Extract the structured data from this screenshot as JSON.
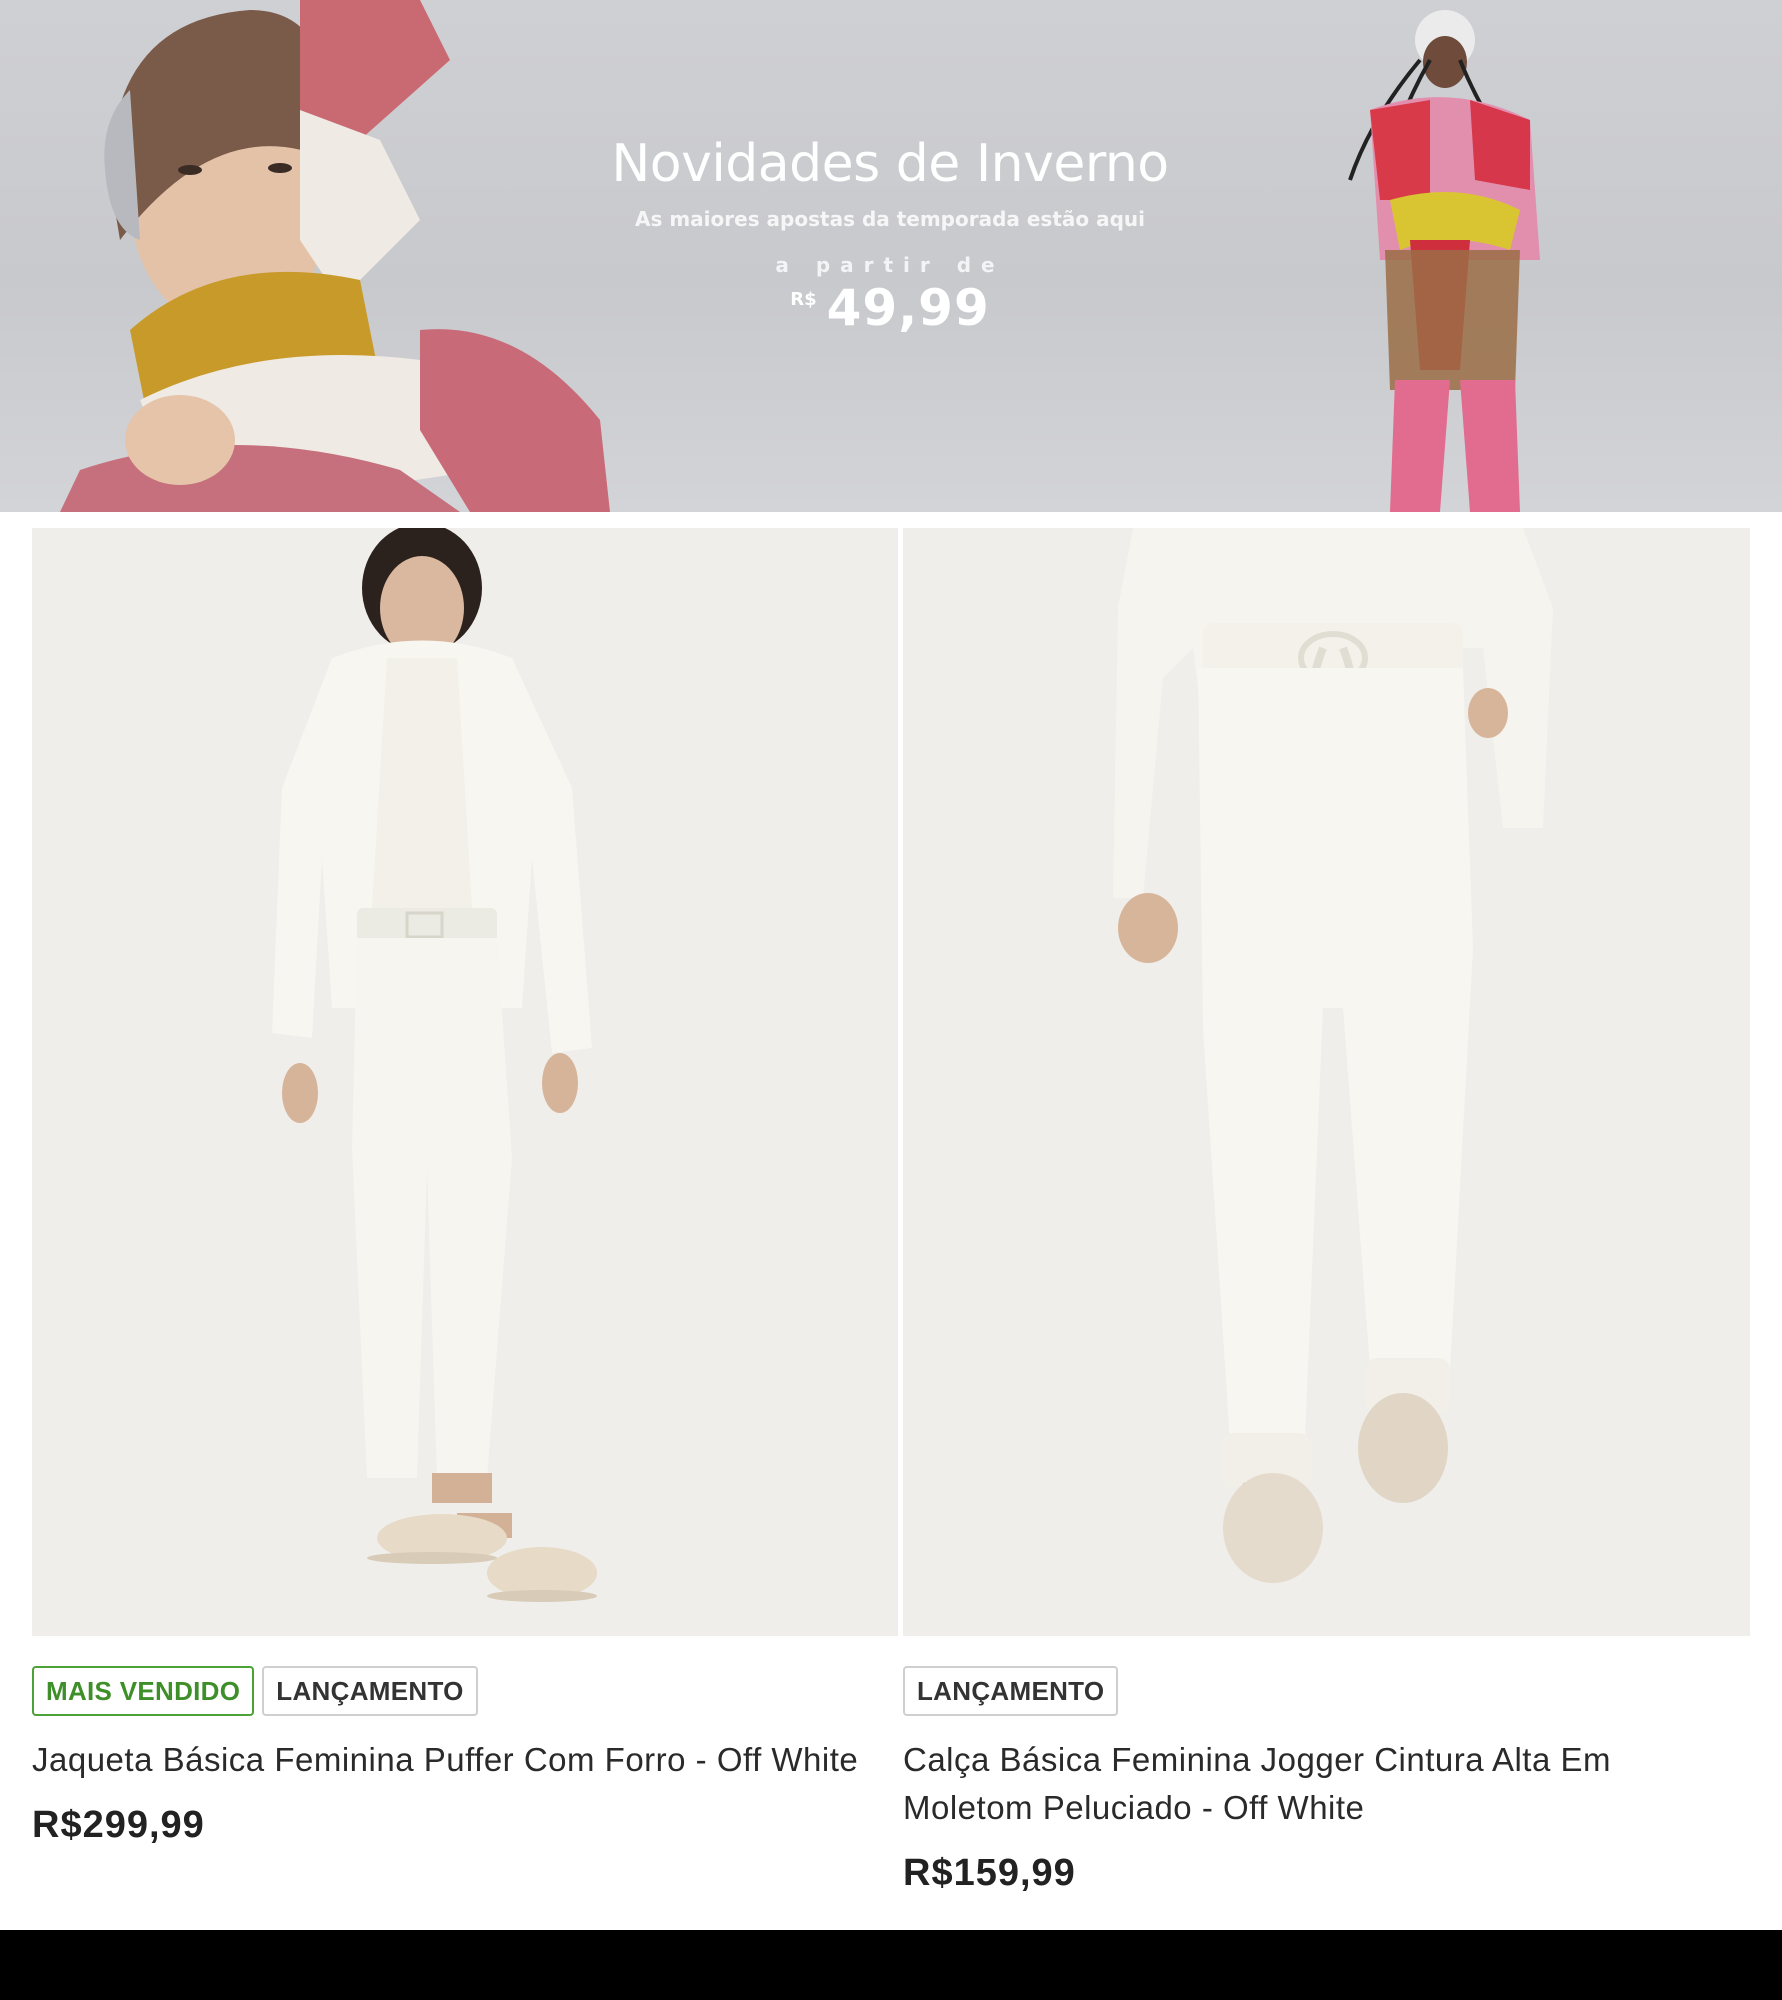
{
  "banner": {
    "title": "Novidades de Inverno",
    "subtitle": "As maiores apostas da temporada estão aqui",
    "from_label": "a partir de",
    "currency": "R$",
    "price": "49,99"
  },
  "products": [
    {
      "badges": [
        "MAIS VENDIDO",
        "LANÇAMENTO"
      ],
      "name": "Jaqueta Básica Feminina Puffer Com Forro - Off White",
      "price": "R$299,99"
    },
    {
      "badges": [
        "LANÇAMENTO"
      ],
      "name": "Calça Básica Feminina Jogger Cintura Alta Em Moletom Peluciado - Off White",
      "price": "R$159,99"
    }
  ],
  "colors": {
    "badge_bestseller": "#4ca236",
    "badge_launch_border": "#cfcfcf",
    "bottom_bar": "#000000"
  }
}
